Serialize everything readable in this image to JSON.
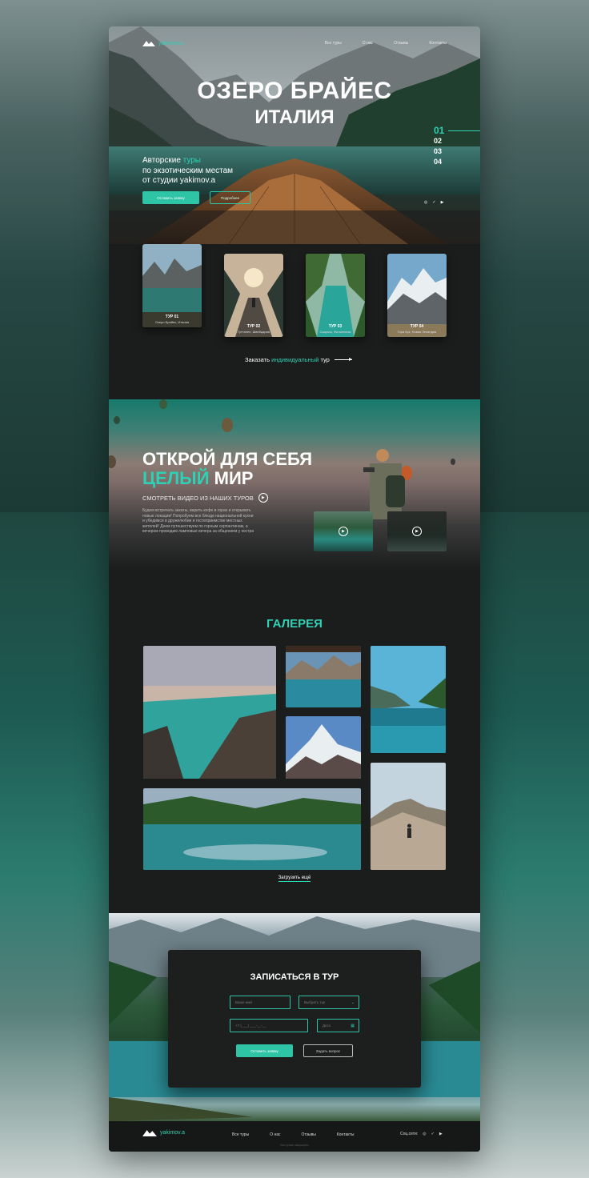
{
  "nav": {
    "logo": "yakimov.a",
    "links": [
      "Все туры",
      "О нас",
      "Отзывы",
      "Контакты"
    ]
  },
  "hero": {
    "title": "ОЗЕРО БРАЙЕС",
    "subtitle": "ИТАЛИЯ",
    "text_line1_a": "Авторские ",
    "text_line1_b": "туры",
    "text_line2": "по экзотическим местам",
    "text_line3": "от студии yakimov.a",
    "btn_primary": "Оставить заявку",
    "btn_secondary": "Подробнее",
    "slides": [
      "01",
      "02",
      "03",
      "04"
    ],
    "socials": [
      "instagram-icon",
      "vk-icon",
      "youtube-icon"
    ]
  },
  "tours": {
    "items": [
      {
        "label": "ТУР 01",
        "place": "Озеро Брайес, Италия"
      },
      {
        "label": "ТУР 02",
        "place": "Гуттанен, Швейцария"
      },
      {
        "label": "ТУР 03",
        "place": "Сиаргао, Филиппины"
      },
      {
        "label": "ТУР 04",
        "place": "Гора Кук, Новая Зеландия"
      }
    ],
    "custom_a": "Заказать ",
    "custom_b": "индивидуальный",
    "custom_c": " тур"
  },
  "discover": {
    "title_line1": "ОТКРОЙ ДЛЯ СЕБЯ",
    "title_accent": "ЦЕЛЫЙ",
    "title_rest": " МИР",
    "video_label": "СМОТРЕТЬ ВИДЕО ИЗ НАШИХ ТУРОВ",
    "body": "Будем встречать закаты, варить кофе в горах и открывать новые локации! Попробуем все блюда национальной кухни и убедимся в дружелюбии и гостеприимстве местных жителей! Днем путешествуем по горным серпантинам, а вечером проводим ламповые вечера за общением у костра"
  },
  "gallery": {
    "title": "ГАЛЕРЕЯ",
    "load_more": "Загрузить ещё"
  },
  "signup": {
    "title": "ЗАПИСАТЬСЯ В ТУР",
    "name_placeholder": "Ваше имя",
    "tour_placeholder": "Выбрать тур",
    "phone_placeholder": "+7 (___) ___-__-__",
    "date_placeholder": "Дата",
    "btn_submit": "Оставить заявку",
    "btn_question": "Задать вопрос"
  },
  "footer": {
    "logo": "yakimov.a",
    "links": [
      "Все туры",
      "О нас",
      "Отзывы",
      "Контакты"
    ],
    "socials_label": "Соц.сети:",
    "copyright": "Все права защищены"
  },
  "colors": {
    "accent": "#2fd1b4",
    "button": "#2ec4a6",
    "background": "#1b1c1c"
  }
}
